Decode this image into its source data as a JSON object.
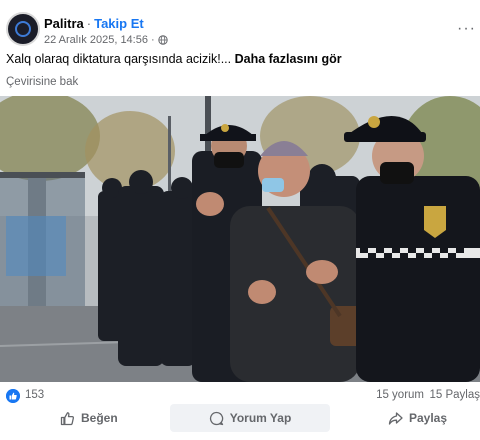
{
  "post": {
    "page_name": "Palitra",
    "separator": "·",
    "follow_label": "Takip Et",
    "date": "22 Aralık 2025, 14:56",
    "dot": "·",
    "more_label": "···",
    "text": "Xalq olaraq diktatura qarşısında acizik!...",
    "see_more_label": "Daha fazlasını gör",
    "translate_label": "Çevirisine bak"
  },
  "photo": {
    "description_icon": "photo-image"
  },
  "stats": {
    "likes": "153",
    "comments": "15 yorum",
    "shares": "15 Paylaş"
  },
  "actions": {
    "like_label": "Beğen",
    "comment_label": "Yorum Yap",
    "share_label": "Paylaş"
  },
  "colors": {
    "brand_blue": "#1877f2",
    "muted": "#65676b"
  }
}
